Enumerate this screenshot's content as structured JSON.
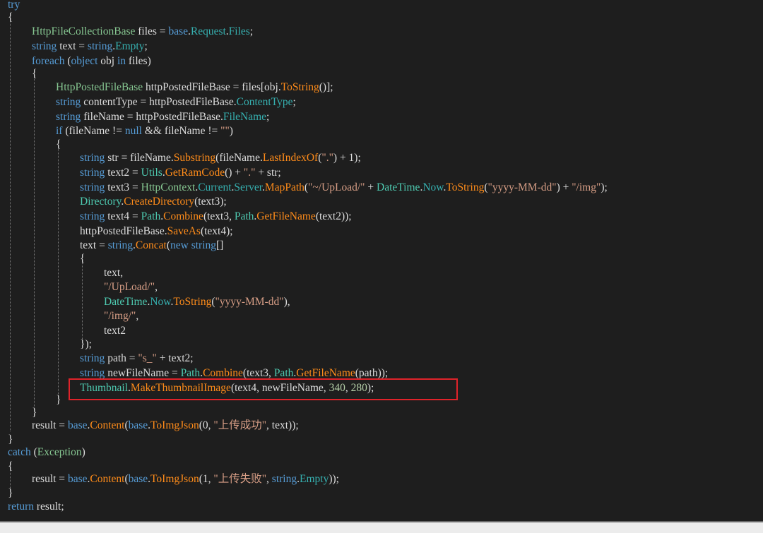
{
  "colors": {
    "background": "#1e1e1e",
    "keyword": "#569cd6",
    "type": "#4ec9b0",
    "type_green": "#86c691",
    "method": "#ff8c1a",
    "property": "#36b0b0",
    "string": "#d69d85",
    "number": "#b5cea8",
    "plain": "#dcdcdc",
    "highlight_border": "#e0232a"
  },
  "code": {
    "lines": [
      {
        "tokens": [
          {
            "t": "kw",
            "v": "try"
          }
        ]
      },
      {
        "tokens": [
          {
            "t": "pl",
            "v": "{"
          }
        ]
      },
      {
        "tokens": [
          {
            "t": "tyg",
            "v": "HttpFileCollectionBase"
          },
          {
            "t": "pl",
            "v": " files = "
          },
          {
            "t": "kw",
            "v": "base"
          },
          {
            "t": "pl",
            "v": "."
          },
          {
            "t": "pr",
            "v": "Request"
          },
          {
            "t": "pl",
            "v": "."
          },
          {
            "t": "pr",
            "v": "Files"
          },
          {
            "t": "pl",
            "v": ";"
          }
        ]
      },
      {
        "tokens": [
          {
            "t": "kw",
            "v": "string"
          },
          {
            "t": "pl",
            "v": " text = "
          },
          {
            "t": "kw",
            "v": "string"
          },
          {
            "t": "pl",
            "v": "."
          },
          {
            "t": "pr",
            "v": "Empty"
          },
          {
            "t": "pl",
            "v": ";"
          }
        ]
      },
      {
        "tokens": [
          {
            "t": "kw",
            "v": "foreach"
          },
          {
            "t": "pl",
            "v": " ("
          },
          {
            "t": "kw",
            "v": "object"
          },
          {
            "t": "pl",
            "v": " obj "
          },
          {
            "t": "kw",
            "v": "in"
          },
          {
            "t": "pl",
            "v": " files)"
          }
        ]
      },
      {
        "tokens": [
          {
            "t": "pl",
            "v": "{"
          }
        ]
      },
      {
        "tokens": [
          {
            "t": "tyg",
            "v": "HttpPostedFileBase"
          },
          {
            "t": "pl",
            "v": " httpPostedFileBase = files[obj."
          },
          {
            "t": "me",
            "v": "ToString"
          },
          {
            "t": "pl",
            "v": "()];"
          }
        ]
      },
      {
        "tokens": [
          {
            "t": "kw",
            "v": "string"
          },
          {
            "t": "pl",
            "v": " contentType = httpPostedFileBase."
          },
          {
            "t": "pr",
            "v": "ContentType"
          },
          {
            "t": "pl",
            "v": ";"
          }
        ]
      },
      {
        "tokens": [
          {
            "t": "kw",
            "v": "string"
          },
          {
            "t": "pl",
            "v": " fileName = httpPostedFileBase."
          },
          {
            "t": "pr",
            "v": "FileName"
          },
          {
            "t": "pl",
            "v": ";"
          }
        ]
      },
      {
        "tokens": [
          {
            "t": "kw",
            "v": "if"
          },
          {
            "t": "pl",
            "v": " (fileName != "
          },
          {
            "t": "kw",
            "v": "null"
          },
          {
            "t": "pl",
            "v": " && fileName != "
          },
          {
            "t": "st",
            "v": "\"\""
          },
          {
            "t": "pl",
            "v": ")"
          }
        ]
      },
      {
        "tokens": [
          {
            "t": "pl",
            "v": "{"
          }
        ]
      },
      {
        "tokens": [
          {
            "t": "kw",
            "v": "string"
          },
          {
            "t": "pl",
            "v": " str = fileName."
          },
          {
            "t": "me",
            "v": "Substring"
          },
          {
            "t": "pl",
            "v": "(fileName."
          },
          {
            "t": "me",
            "v": "LastIndexOf"
          },
          {
            "t": "pl",
            "v": "("
          },
          {
            "t": "st",
            "v": "\".\""
          },
          {
            "t": "pl",
            "v": ") + 1);"
          }
        ]
      },
      {
        "tokens": [
          {
            "t": "kw",
            "v": "string"
          },
          {
            "t": "pl",
            "v": " text2 = "
          },
          {
            "t": "ty",
            "v": "Utils"
          },
          {
            "t": "pl",
            "v": "."
          },
          {
            "t": "me",
            "v": "GetRamCode"
          },
          {
            "t": "pl",
            "v": "() + "
          },
          {
            "t": "st",
            "v": "\".\""
          },
          {
            "t": "pl",
            "v": " + str;"
          }
        ]
      },
      {
        "tokens": [
          {
            "t": "kw",
            "v": "string"
          },
          {
            "t": "pl",
            "v": " text3 = "
          },
          {
            "t": "tyg",
            "v": "HttpContext"
          },
          {
            "t": "pl",
            "v": "."
          },
          {
            "t": "pr",
            "v": "Current"
          },
          {
            "t": "pl",
            "v": "."
          },
          {
            "t": "pr",
            "v": "Server"
          },
          {
            "t": "pl",
            "v": "."
          },
          {
            "t": "me",
            "v": "MapPath"
          },
          {
            "t": "pl",
            "v": "("
          },
          {
            "t": "st",
            "v": "\"~/UpLoad/\""
          },
          {
            "t": "pl",
            "v": " + "
          },
          {
            "t": "ty",
            "v": "DateTime"
          },
          {
            "t": "pl",
            "v": "."
          },
          {
            "t": "pr",
            "v": "Now"
          },
          {
            "t": "pl",
            "v": "."
          },
          {
            "t": "me",
            "v": "ToString"
          },
          {
            "t": "pl",
            "v": "("
          },
          {
            "t": "st",
            "v": "\"yyyy-MM-dd\""
          },
          {
            "t": "pl",
            "v": ") + "
          },
          {
            "t": "st",
            "v": "\"/img\""
          },
          {
            "t": "pl",
            "v": ");"
          }
        ]
      },
      {
        "tokens": [
          {
            "t": "ty",
            "v": "Directory"
          },
          {
            "t": "pl",
            "v": "."
          },
          {
            "t": "me",
            "v": "CreateDirectory"
          },
          {
            "t": "pl",
            "v": "(text3);"
          }
        ]
      },
      {
        "tokens": [
          {
            "t": "kw",
            "v": "string"
          },
          {
            "t": "pl",
            "v": " text4 = "
          },
          {
            "t": "ty",
            "v": "Path"
          },
          {
            "t": "pl",
            "v": "."
          },
          {
            "t": "me",
            "v": "Combine"
          },
          {
            "t": "pl",
            "v": "(text3, "
          },
          {
            "t": "ty",
            "v": "Path"
          },
          {
            "t": "pl",
            "v": "."
          },
          {
            "t": "me",
            "v": "GetFileName"
          },
          {
            "t": "pl",
            "v": "(text2));"
          }
        ]
      },
      {
        "tokens": [
          {
            "t": "pl",
            "v": "httpPostedFileBase."
          },
          {
            "t": "me",
            "v": "SaveAs"
          },
          {
            "t": "pl",
            "v": "(text4);"
          }
        ]
      },
      {
        "tokens": [
          {
            "t": "pl",
            "v": "text = "
          },
          {
            "t": "kw",
            "v": "string"
          },
          {
            "t": "pl",
            "v": "."
          },
          {
            "t": "me",
            "v": "Concat"
          },
          {
            "t": "pl",
            "v": "("
          },
          {
            "t": "kw",
            "v": "new"
          },
          {
            "t": "pl",
            "v": " "
          },
          {
            "t": "kw",
            "v": "string"
          },
          {
            "t": "pl",
            "v": "[]"
          }
        ]
      },
      {
        "tokens": [
          {
            "t": "pl",
            "v": "{"
          }
        ]
      },
      {
        "tokens": [
          {
            "t": "pl",
            "v": "text,"
          }
        ]
      },
      {
        "tokens": [
          {
            "t": "st",
            "v": "\"/UpLoad/\""
          },
          {
            "t": "pl",
            "v": ","
          }
        ]
      },
      {
        "tokens": [
          {
            "t": "ty",
            "v": "DateTime"
          },
          {
            "t": "pl",
            "v": "."
          },
          {
            "t": "pr",
            "v": "Now"
          },
          {
            "t": "pl",
            "v": "."
          },
          {
            "t": "me",
            "v": "ToString"
          },
          {
            "t": "pl",
            "v": "("
          },
          {
            "t": "st",
            "v": "\"yyyy-MM-dd\""
          },
          {
            "t": "pl",
            "v": "),"
          }
        ]
      },
      {
        "tokens": [
          {
            "t": "st",
            "v": "\"/img/\""
          },
          {
            "t": "pl",
            "v": ","
          }
        ]
      },
      {
        "tokens": [
          {
            "t": "pl",
            "v": "text2"
          }
        ]
      },
      {
        "tokens": [
          {
            "t": "pl",
            "v": "});"
          }
        ]
      },
      {
        "tokens": [
          {
            "t": "kw",
            "v": "string"
          },
          {
            "t": "pl",
            "v": " path = "
          },
          {
            "t": "st",
            "v": "\"s_\""
          },
          {
            "t": "pl",
            "v": " + text2;"
          }
        ]
      },
      {
        "tokens": [
          {
            "t": "kw",
            "v": "string"
          },
          {
            "t": "pl",
            "v": " newFileName = "
          },
          {
            "t": "ty",
            "v": "Path"
          },
          {
            "t": "pl",
            "v": "."
          },
          {
            "t": "me",
            "v": "Combine"
          },
          {
            "t": "pl",
            "v": "(text3, "
          },
          {
            "t": "ty",
            "v": "Path"
          },
          {
            "t": "pl",
            "v": "."
          },
          {
            "t": "me",
            "v": "GetFileName"
          },
          {
            "t": "pl",
            "v": "(path));"
          }
        ]
      },
      {
        "tokens": [
          {
            "t": "ty",
            "v": "Thumbnail"
          },
          {
            "t": "pl",
            "v": "."
          },
          {
            "t": "me",
            "v": "MakeThumbnailImage"
          },
          {
            "t": "pl",
            "v": "(text4, newFileName, "
          },
          {
            "t": "nu",
            "v": "340"
          },
          {
            "t": "pl",
            "v": ", "
          },
          {
            "t": "nu",
            "v": "280"
          },
          {
            "t": "pl",
            "v": ");"
          }
        ]
      },
      {
        "tokens": [
          {
            "t": "pl",
            "v": "}"
          }
        ]
      },
      {
        "tokens": [
          {
            "t": "pl",
            "v": "}"
          }
        ]
      },
      {
        "tokens": [
          {
            "t": "pl",
            "v": "result = "
          },
          {
            "t": "kw",
            "v": "base"
          },
          {
            "t": "pl",
            "v": "."
          },
          {
            "t": "me",
            "v": "Content"
          },
          {
            "t": "pl",
            "v": "("
          },
          {
            "t": "kw",
            "v": "base"
          },
          {
            "t": "pl",
            "v": "."
          },
          {
            "t": "me",
            "v": "ToImgJson"
          },
          {
            "t": "pl",
            "v": "(0, "
          },
          {
            "t": "st",
            "v": "\"上传成功\""
          },
          {
            "t": "pl",
            "v": ", text));"
          }
        ]
      },
      {
        "tokens": [
          {
            "t": "pl",
            "v": "}"
          }
        ]
      },
      {
        "tokens": [
          {
            "t": "kw",
            "v": "catch"
          },
          {
            "t": "pl",
            "v": " ("
          },
          {
            "t": "tyg",
            "v": "Exception"
          },
          {
            "t": "pl",
            "v": ")"
          }
        ]
      },
      {
        "tokens": [
          {
            "t": "pl",
            "v": "{"
          }
        ]
      },
      {
        "tokens": [
          {
            "t": "pl",
            "v": "result = "
          },
          {
            "t": "kw",
            "v": "base"
          },
          {
            "t": "pl",
            "v": "."
          },
          {
            "t": "me",
            "v": "Content"
          },
          {
            "t": "pl",
            "v": "("
          },
          {
            "t": "kw",
            "v": "base"
          },
          {
            "t": "pl",
            "v": "."
          },
          {
            "t": "me",
            "v": "ToImgJson"
          },
          {
            "t": "pl",
            "v": "(1, "
          },
          {
            "t": "st",
            "v": "\"上传失败\""
          },
          {
            "t": "pl",
            "v": ", "
          },
          {
            "t": "kw",
            "v": "string"
          },
          {
            "t": "pl",
            "v": "."
          },
          {
            "t": "pr",
            "v": "Empty"
          },
          {
            "t": "pl",
            "v": "));"
          }
        ]
      },
      {
        "tokens": [
          {
            "t": "pl",
            "v": "}"
          }
        ]
      },
      {
        "tokens": [
          {
            "t": "kw",
            "v": "return"
          },
          {
            "t": "pl",
            "v": " result;"
          }
        ]
      }
    ]
  }
}
